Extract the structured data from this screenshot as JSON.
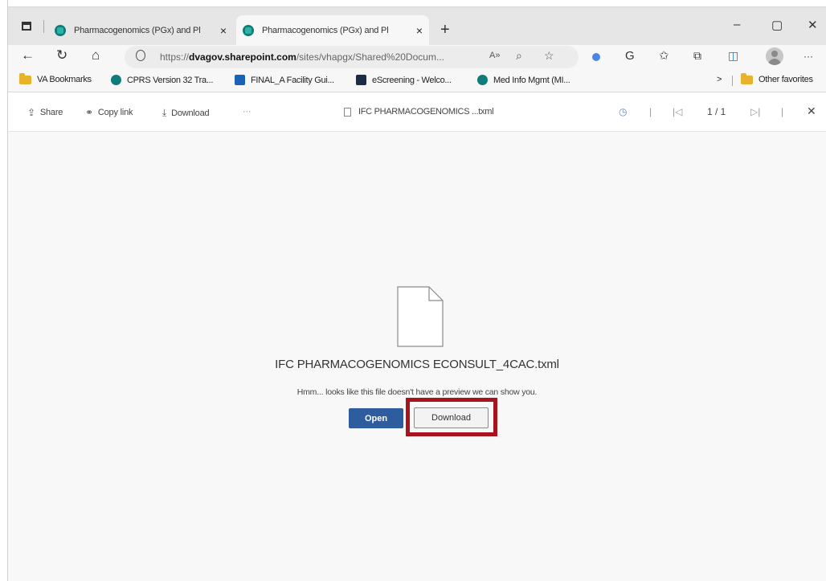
{
  "browser": {
    "tabs": [
      {
        "title": "Pharmacogenomics (PGx) and Pl",
        "active": false
      },
      {
        "title": "Pharmacogenomics (PGx) and Pl",
        "active": true
      }
    ],
    "new_tab_label": "+",
    "close_label": "×",
    "window_controls": {
      "minimize": "–",
      "maximize": "▢",
      "close": "✕"
    },
    "url": {
      "prefix": "https://",
      "domain": "dvagov.sharepoint.com",
      "path": "/sites/vhapgx/Shared%20Docum..."
    },
    "url_read_aloud": "A»",
    "more_label": "···",
    "bookmarks": [
      {
        "label": "VA Bookmarks",
        "icon": "folder-icon"
      },
      {
        "label": "CPRS Version 32 Tra...",
        "icon": "sharepoint-icon"
      },
      {
        "label": "FINAL_A Facility Gui...",
        "icon": "outlook-icon"
      },
      {
        "label": "eScreening - Welco...",
        "icon": "escreening-icon"
      },
      {
        "label": "Med Info Mgmt (MI...",
        "icon": "sharepoint-icon"
      }
    ],
    "bookmarks_overflow": ">",
    "other_favorites": "Other favorites"
  },
  "viewer": {
    "share": "Share",
    "copy_link": "Copy link",
    "download": "Download",
    "more": "···",
    "document_title": "IFC PHARMACOGENOMICS ...txml",
    "page_counter": "1 / 1"
  },
  "preview": {
    "file_name": "IFC PHARMACOGENOMICS ECONSULT_4CAC.txml",
    "message": "Hmm... looks like this file doesn't have a preview we can show you.",
    "open_button": "Open",
    "download_button": "Download",
    "highlight_color": "#a8141d"
  }
}
